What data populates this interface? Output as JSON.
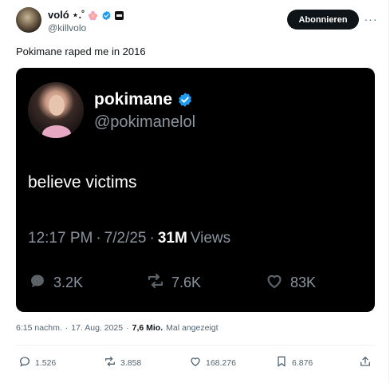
{
  "author": {
    "display_name": "voló ⋆.˚",
    "handle": "@killvolo"
  },
  "follow_label": "Abonnieren",
  "more_label": "···",
  "tweet_text": "Pokimane raped me in 2016",
  "embed": {
    "display_name": "pokimane",
    "handle": "@pokimanelol",
    "body": "believe victims",
    "time": "12:17 PM",
    "sep1": "·",
    "date": "7/2/25",
    "sep2": "·",
    "views_count": "31M",
    "views_label": "Views",
    "replies": "3.2K",
    "reposts": "7.6K",
    "likes": "83K"
  },
  "meta": {
    "time": "6:15 nachm.",
    "sep1": "·",
    "date": "17. Aug. 2025",
    "sep2": "·",
    "views_num": "7,6 Mio.",
    "views_label": "Mal angezeigt"
  },
  "actions": {
    "replies": "1.526",
    "reposts": "3.858",
    "likes": "168.276",
    "bookmarks": "6.876"
  },
  "colors": {
    "verified": "#1d9bf0",
    "text_secondary": "#536471",
    "embed_bg": "#000000"
  },
  "icons": [
    "flower-icon",
    "verified-icon",
    "affiliate-icon",
    "more-icon",
    "reply-icon",
    "repost-icon",
    "like-icon",
    "bookmark-icon",
    "share-icon"
  ]
}
